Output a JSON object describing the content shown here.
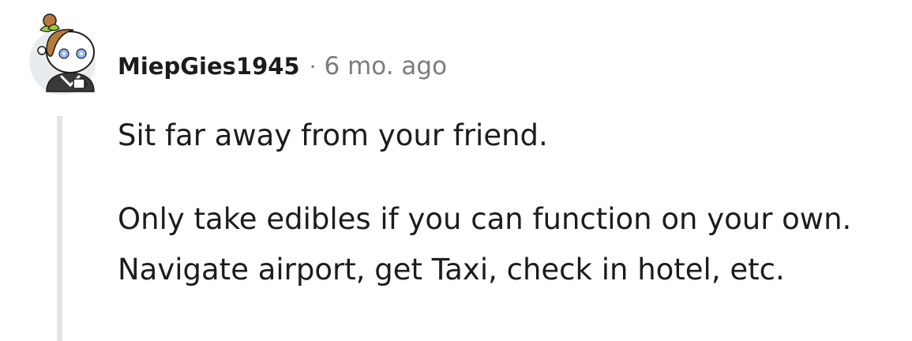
{
  "comment": {
    "username": "MiepGies1945",
    "separator": "·",
    "timestamp": "6 mo. ago",
    "avatar_icon": "snoo-avatar-icon",
    "paragraphs": [
      "Sit far away from your friend.",
      "Only take edibles if you can function on your own. Navigate airport, get Taxi, check in hotel, etc."
    ]
  }
}
